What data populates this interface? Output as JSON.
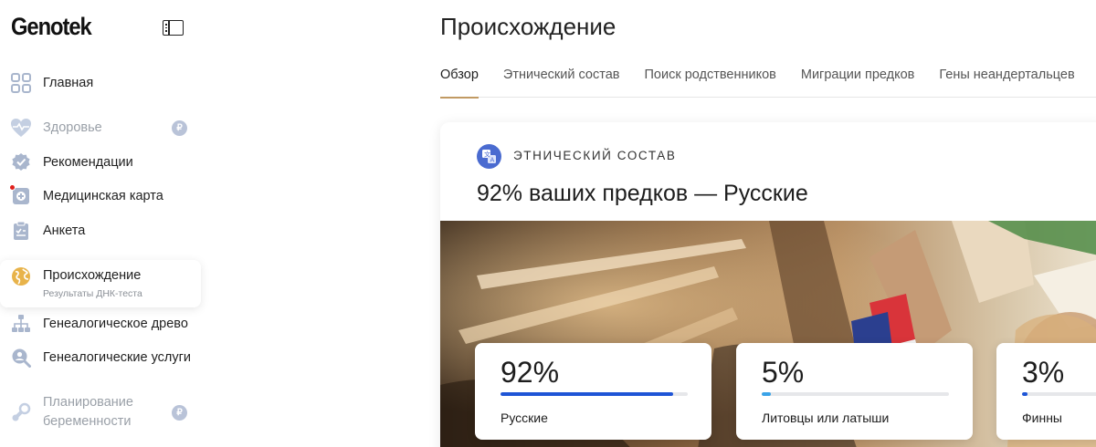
{
  "app": {
    "logo": "Genotek"
  },
  "sidebar": {
    "items": [
      {
        "label": "Главная"
      },
      {
        "label": "Здоровье",
        "badge": "₽"
      },
      {
        "label": "Рекомендации"
      },
      {
        "label": "Медицинская карта"
      },
      {
        "label": "Анкета"
      },
      {
        "label": "Происхождение",
        "sublabel": "Результаты ДНК-теста"
      },
      {
        "label": "Генеалогическое древо"
      },
      {
        "label": "Генеалогические услуги"
      },
      {
        "label": "Планирование беременности",
        "badge": "₽"
      }
    ]
  },
  "main": {
    "title": "Происхождение",
    "tabs": [
      {
        "label": "Обзор"
      },
      {
        "label": "Этнический состав"
      },
      {
        "label": "Поиск родственников"
      },
      {
        "label": "Миграции предков"
      },
      {
        "label": "Гены неандертальцев"
      }
    ]
  },
  "card": {
    "kicker": "ЭТНИЧЕСКИЙ СОСТАВ",
    "headline": "92% ваших предков — Русские",
    "stats": [
      {
        "percent": "92%",
        "value": 92,
        "name": "Русские",
        "color": "#1e55d6"
      },
      {
        "percent": "5%",
        "value": 5,
        "name": "Литовцы или латыши",
        "color": "#3aa3e8"
      },
      {
        "percent": "3%",
        "value": 3,
        "name": "Финны",
        "color": "#1e55d6"
      }
    ]
  },
  "colors": {
    "accent": "#c19a63",
    "brand_blue": "#4a6bd0",
    "badge": "#b9c3d8",
    "alert": "#e0201c"
  }
}
